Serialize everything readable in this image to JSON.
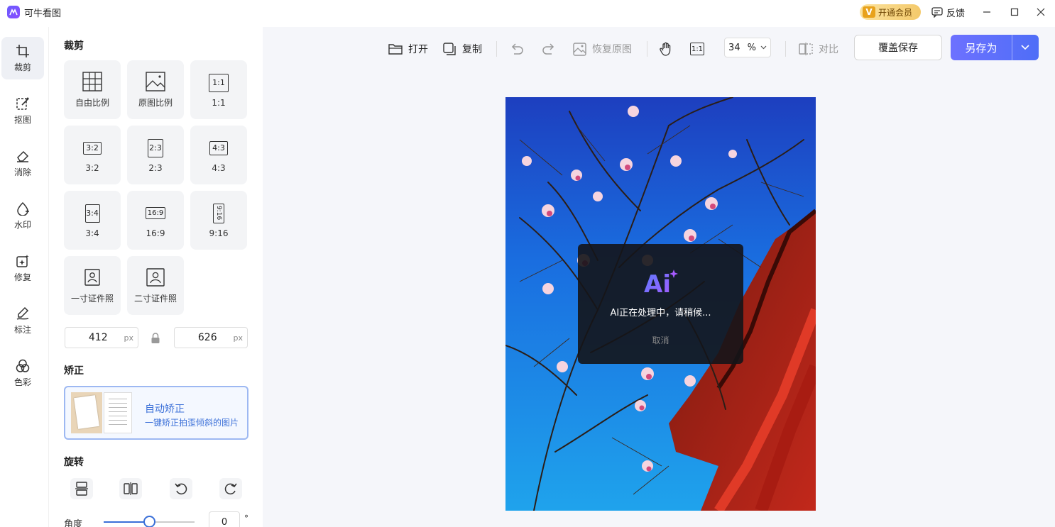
{
  "app": {
    "title": "可牛看图"
  },
  "header": {
    "vip_v": "V",
    "vip_label": "开通会员",
    "feedback_label": "反馈"
  },
  "rail": {
    "items": [
      {
        "label": "裁剪",
        "icon": "crop-icon",
        "active": true
      },
      {
        "label": "抠图",
        "icon": "cutout-icon"
      },
      {
        "label": "消除",
        "icon": "eraser-icon"
      },
      {
        "label": "水印",
        "icon": "watermark-icon"
      },
      {
        "label": "修复",
        "icon": "repair-icon"
      },
      {
        "label": "标注",
        "icon": "annotate-icon"
      },
      {
        "label": "色彩",
        "icon": "color-icon"
      }
    ]
  },
  "panel": {
    "crop_title": "裁剪",
    "crop_options": [
      {
        "label": "自由比例",
        "icon": "grid-icon"
      },
      {
        "label": "原图比例",
        "icon": "image-icon"
      },
      {
        "label": "1:1",
        "glyph": "1:1"
      },
      {
        "label": "3:2",
        "glyph": "3:2"
      },
      {
        "label": "2:3",
        "glyph": "2:3"
      },
      {
        "label": "4:3",
        "glyph": "4:3"
      },
      {
        "label": "3:4",
        "glyph": "3:4"
      },
      {
        "label": "16:9",
        "glyph": "16:9"
      },
      {
        "label": "9:16",
        "glyph": "9:16"
      },
      {
        "label": "一寸证件照",
        "icon": "id-photo-icon"
      },
      {
        "label": "二寸证件照",
        "icon": "id-photo-icon"
      }
    ],
    "width": {
      "value": "412",
      "unit": "px"
    },
    "height": {
      "value": "626",
      "unit": "px"
    },
    "correct_title": "矫正",
    "auto_correct": {
      "title": "自动矫正",
      "desc": "一键矫正拍歪倾斜的图片"
    },
    "rotate_title": "旋转",
    "angle": {
      "label": "角度",
      "value": "0",
      "unit": "°",
      "slider_fraction": 0.5
    }
  },
  "toolbar": {
    "open": "打开",
    "copy": "复制",
    "restore": "恢复原图",
    "zoom_value": "34",
    "zoom_unit": "%",
    "compare": "对比",
    "overwrite_save": "覆盖保存",
    "save_as": "另存为",
    "actual_size_glyph": "1:1"
  },
  "ai_dialog": {
    "logo_text": "Ai",
    "message": "AI正在处理中，请稍候...",
    "cancel": "取消"
  },
  "colors": {
    "accent": "#4f6ef7",
    "accent_light": "#9db8f2",
    "vip_gold": "#f4c96a",
    "canvas_bg": "#f5f6fa"
  }
}
